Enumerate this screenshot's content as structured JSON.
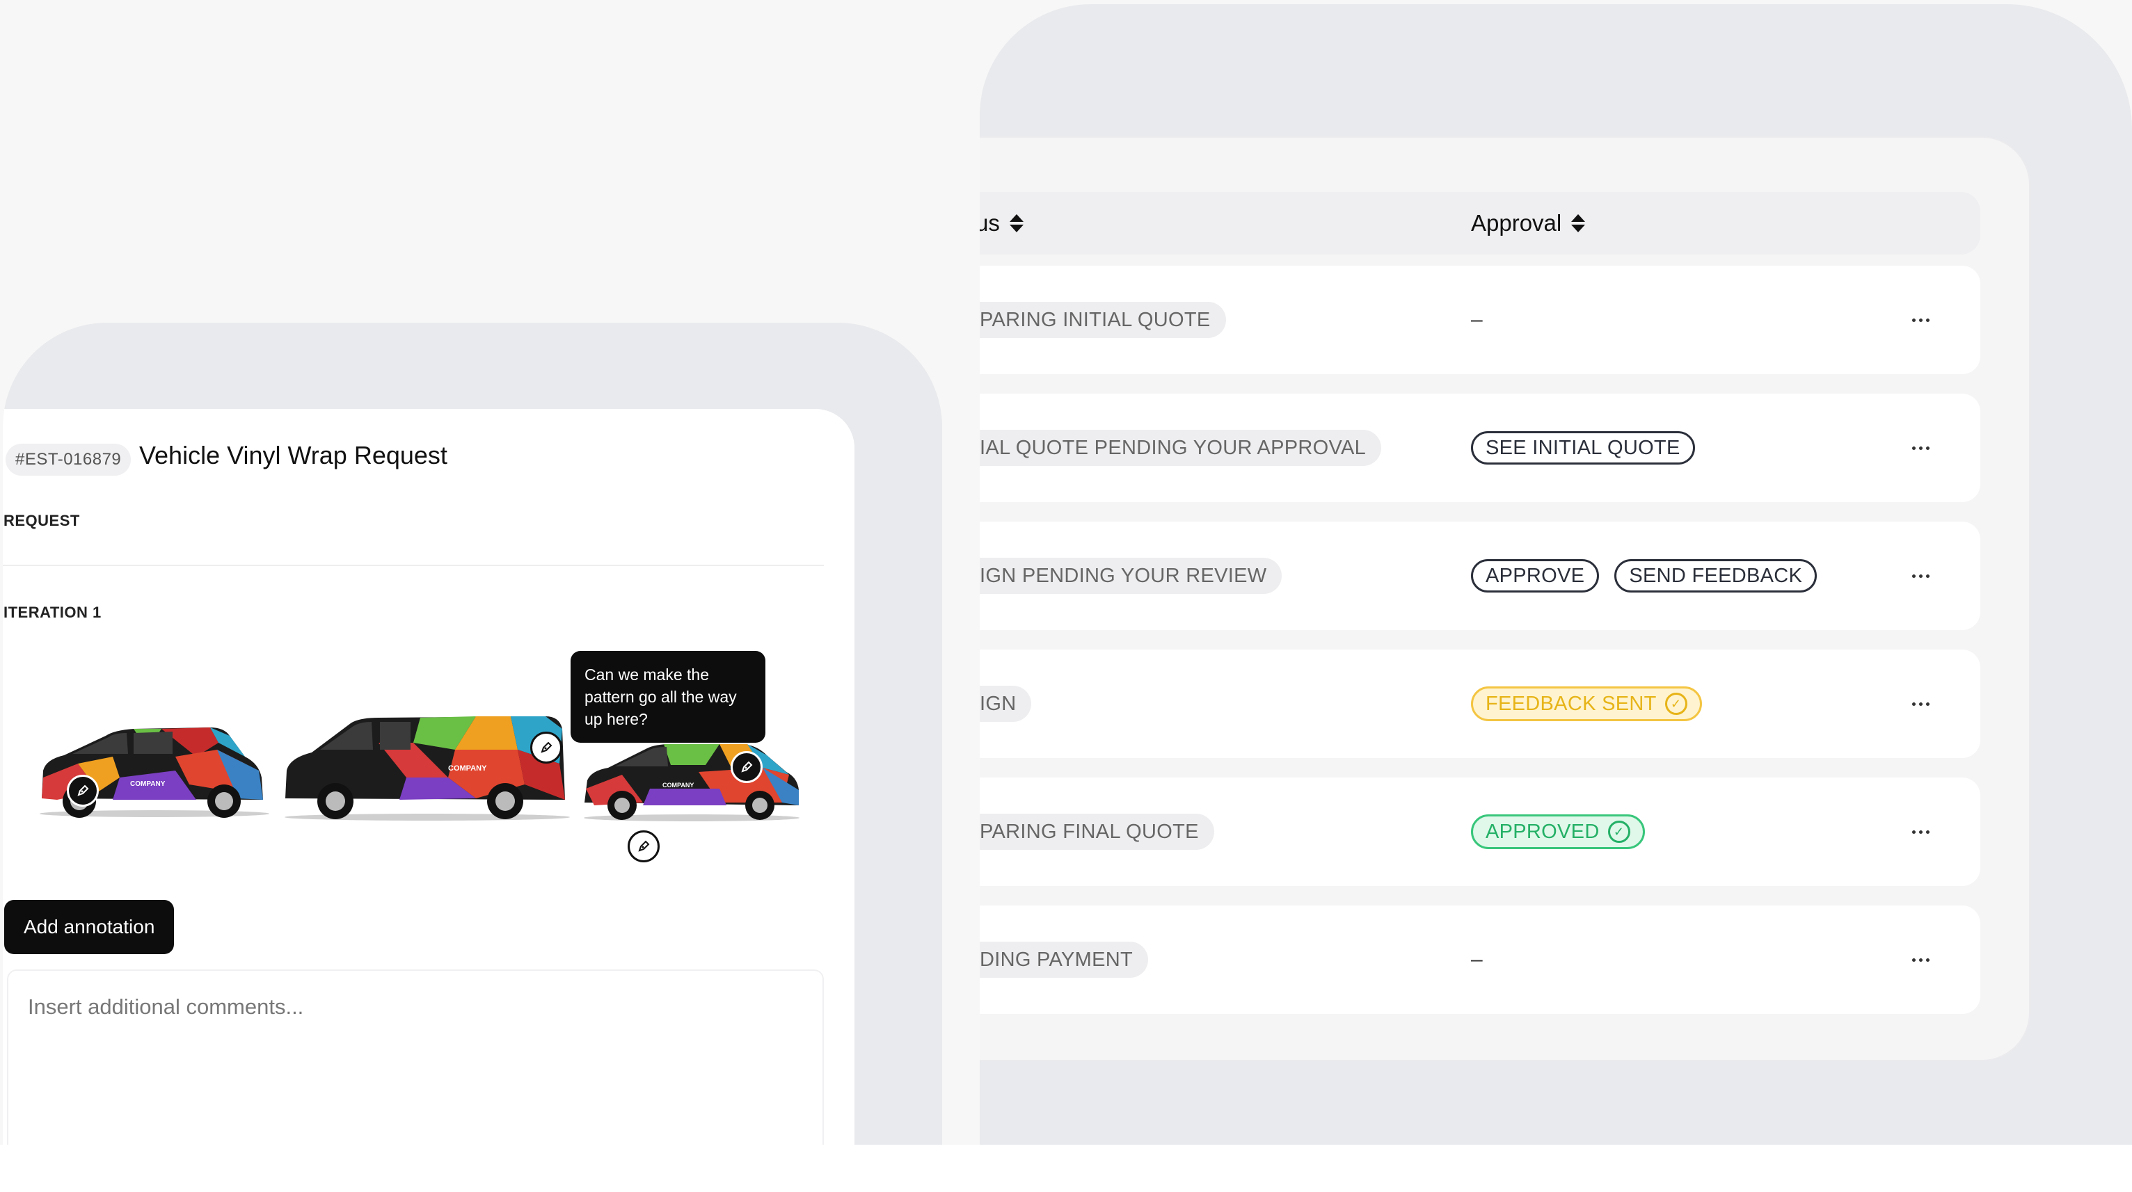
{
  "table": {
    "columns": {
      "status": "us",
      "approval": "Approval"
    },
    "rows": [
      {
        "status": "PARING INITIAL QUOTE",
        "approval_type": "dash",
        "approval_text": "–"
      },
      {
        "status": "IAL QUOTE PENDING YOUR APPROVAL",
        "approval_type": "buttons",
        "buttons": [
          "SEE INITIAL QUOTE"
        ]
      },
      {
        "status": "IGN PENDING YOUR REVIEW",
        "approval_type": "buttons",
        "buttons": [
          "APPROVE",
          "SEND FEEDBACK"
        ]
      },
      {
        "status": "IGN",
        "approval_type": "badge",
        "badge_text": "FEEDBACK SENT",
        "badge_color": "#f4c542"
      },
      {
        "status": "PARING FINAL QUOTE",
        "approval_type": "badge",
        "badge_text": "APPROVED",
        "badge_color": "#38c67b"
      },
      {
        "status": "DING PAYMENT",
        "approval_type": "dash",
        "approval_text": "–"
      }
    ],
    "more_icon": "more-horizontal-icon"
  },
  "request": {
    "id": "#EST-016879",
    "title": "Vehicle Vinyl Wrap Request",
    "section_label": "REQUEST",
    "iteration_label": "ITERATION 1",
    "annotation_comment": "Can we make the pattern go all the way up here?",
    "vehicle_brand_text": "COMPANY",
    "add_annotation_label": "Add annotation",
    "comments_placeholder": "Insert additional comments..."
  },
  "colors": {
    "page_bg": "#f7f7f7",
    "panel_bg": "#e9eaed",
    "badge_yellow": "#f4c542",
    "badge_green": "#38c67b",
    "ink": "#0d0d0d"
  }
}
